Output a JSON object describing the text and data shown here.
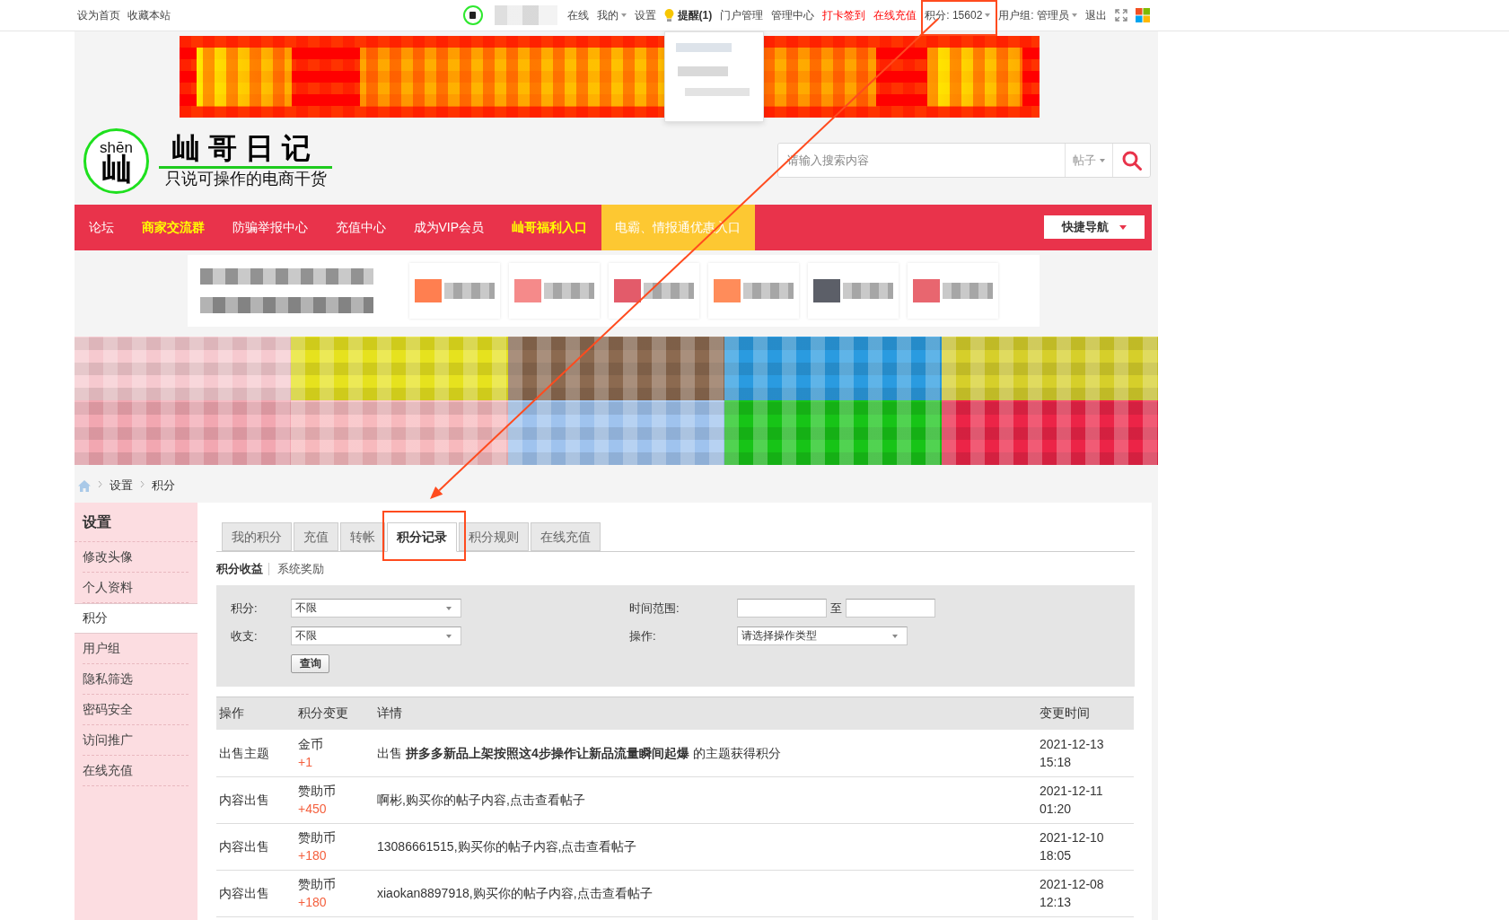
{
  "top_bar": {
    "left_links": [
      "设为首页",
      "收藏本站"
    ],
    "user": {
      "name_hidden": true
    },
    "links": [
      {
        "label": "在线",
        "kind": "link",
        "caret": false,
        "expanded": false,
        "annotated": false
      },
      {
        "label": "我的",
        "kind": "link",
        "caret": true,
        "expanded": false,
        "annotated": false
      },
      {
        "label": "设置",
        "kind": "link",
        "caret": false,
        "expanded": false,
        "annotated": false
      },
      {
        "label": "提醒(1)",
        "kind": "reminder",
        "caret": false,
        "expanded": true,
        "annotated": false
      },
      {
        "label": "门户管理",
        "kind": "link",
        "caret": false,
        "expanded": false,
        "annotated": false
      },
      {
        "label": "管理中心",
        "kind": "link",
        "caret": false,
        "expanded": false,
        "annotated": false
      },
      {
        "label": "打卡签到",
        "kind": "alert",
        "caret": false,
        "expanded": false,
        "annotated": false
      },
      {
        "label": "在线充值",
        "kind": "alert",
        "caret": false,
        "expanded": false,
        "annotated": false
      },
      {
        "label": "积分: 15602",
        "kind": "link",
        "caret": true,
        "expanded": false,
        "annotated": true
      },
      {
        "label": "用户组: 管理员",
        "kind": "link",
        "caret": true,
        "expanded": false,
        "annotated": false
      },
      {
        "label": "退出",
        "kind": "link",
        "caret": false,
        "expanded": false,
        "annotated": false
      }
    ]
  },
  "banner": {
    "blurred": true
  },
  "header": {
    "logo": {
      "pinyin": "shēn",
      "glyph": "屾",
      "title": "屾哥日记",
      "tagline": "只说可操作的电商干货"
    },
    "search": {
      "placeholder": "请输入搜索内容",
      "scope": "帖子"
    }
  },
  "nav": {
    "items": [
      {
        "label": "论坛",
        "kind": "plain"
      },
      {
        "label": "商家交流群",
        "kind": "highlight"
      },
      {
        "label": "防骗举报中心",
        "kind": "plain"
      },
      {
        "label": "充值中心",
        "kind": "plain"
      },
      {
        "label": "成为VIP会员",
        "kind": "plain"
      },
      {
        "label": "屾哥福利入口",
        "kind": "highlight"
      },
      {
        "label": "电霸、情报通优惠入口",
        "kind": "promo"
      }
    ],
    "quick_nav": "快捷导航"
  },
  "promo_strip": {
    "tiles": [
      {
        "color": "#ff7f50"
      },
      {
        "color": "#f58a8a"
      },
      {
        "color": "#e35b6a"
      },
      {
        "color": "#ff8c5a"
      },
      {
        "color": "#5c5f68"
      },
      {
        "color": "#e8666f"
      }
    ]
  },
  "image_grid": {
    "tiles": [
      {
        "color": "#f6c9cf"
      },
      {
        "color": "#e6e21e"
      },
      {
        "color": "#8c6a50"
      },
      {
        "color": "#2a9be0"
      },
      {
        "color": "#d6cf2a"
      },
      {
        "color": "#f2a7b1"
      },
      {
        "color": "#f7b9bd"
      },
      {
        "color": "#9fc3ee"
      },
      {
        "color": "#17c417"
      },
      {
        "color": "#ec2447"
      }
    ]
  },
  "breadcrumb": [
    "设置",
    "积分"
  ],
  "sidebar": {
    "title": "设置",
    "items": [
      {
        "label": "修改头像",
        "selected": false
      },
      {
        "label": "个人资料",
        "selected": false
      },
      {
        "label": "积分",
        "selected": true
      },
      {
        "label": "用户组",
        "selected": false
      },
      {
        "label": "隐私筛选",
        "selected": false
      },
      {
        "label": "密码安全",
        "selected": false
      },
      {
        "label": "访问推广",
        "selected": false
      },
      {
        "label": "在线充值",
        "selected": false
      }
    ]
  },
  "tabs": [
    {
      "label": "我的积分",
      "selected": false,
      "annotated": false
    },
    {
      "label": "充值",
      "selected": false,
      "annotated": false
    },
    {
      "label": "转帐",
      "selected": false,
      "annotated": false
    },
    {
      "label": "积分记录",
      "selected": true,
      "annotated": true
    },
    {
      "label": "积分规则",
      "selected": false,
      "annotated": false
    },
    {
      "label": "在线充值",
      "selected": false,
      "annotated": false
    }
  ],
  "subtabs": [
    {
      "label": "积分收益",
      "selected": true
    },
    {
      "label": "系统奖励",
      "selected": false
    }
  ],
  "filter": {
    "fields": [
      {
        "label": "积分:",
        "kind": "select",
        "value": "不限"
      },
      {
        "label": "时间范围:",
        "kind": "range",
        "separator": "至"
      },
      {
        "label": "收支:",
        "kind": "select",
        "value": "不限"
      },
      {
        "label": "操作:",
        "kind": "select",
        "value": "请选择操作类型"
      }
    ],
    "button": "查询"
  },
  "table": {
    "columns": [
      "操作",
      "积分变更",
      "详情",
      "变更时间"
    ],
    "rows": [
      {
        "action": "出售主题",
        "currency": "金币",
        "amount": "+1",
        "detail": "出售 **拼多多新品上架按照这4步操作让新品流量瞬间起爆** 的主题获得积分",
        "time": "2021-12-13 15:18"
      },
      {
        "action": "内容出售",
        "currency": "赞助币",
        "amount": "+450",
        "detail": "啊彬,购买你的帖子内容,点击查看帖子",
        "time": "2021-12-11 01:20"
      },
      {
        "action": "内容出售",
        "currency": "赞助币",
        "amount": "+180",
        "detail": "13086661515,购买你的帖子内容,点击查看帖子",
        "time": "2021-12-10 18:05"
      },
      {
        "action": "内容出售",
        "currency": "赞助币",
        "amount": "+180",
        "detail": "xiaokan8897918,购买你的帖子内容,点击查看帖子",
        "time": "2021-12-08 12:13"
      }
    ]
  },
  "annotation_arrow": true
}
